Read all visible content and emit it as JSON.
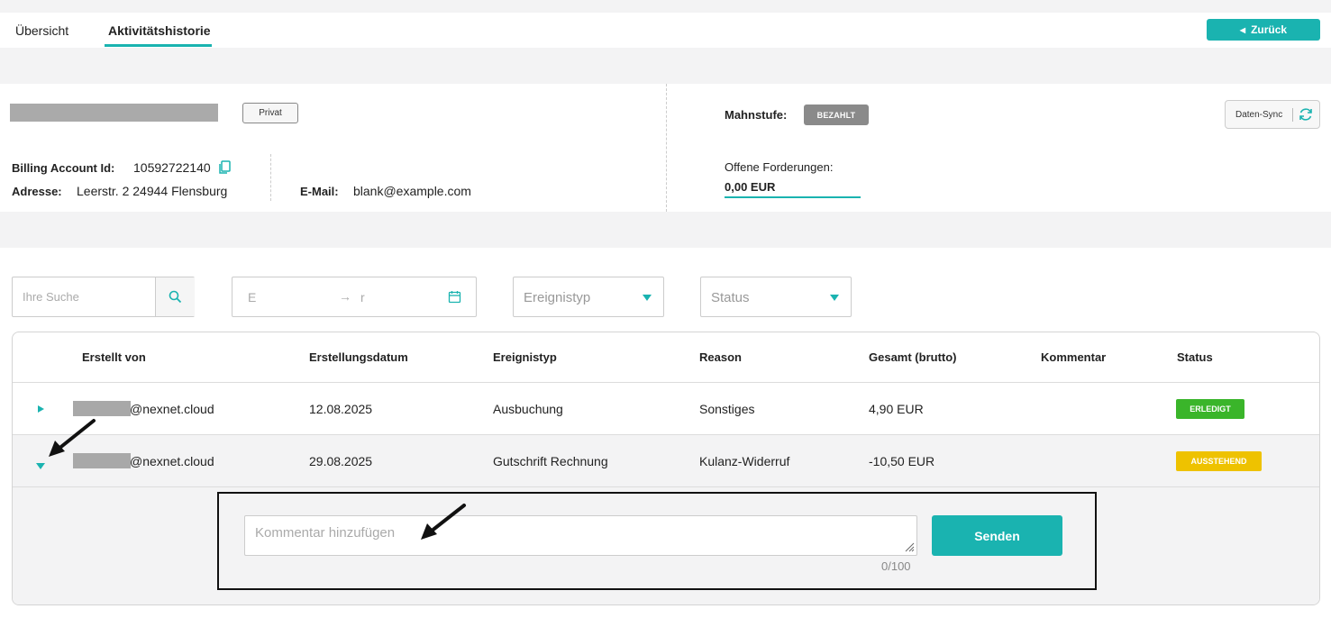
{
  "tabs": {
    "overview": "Übersicht",
    "history": "Aktivitätshistorie"
  },
  "back_button": "Zurück",
  "account": {
    "badge": "Privat",
    "billing_label": "Billing Account Id:",
    "billing_id": "10592722140",
    "address_label": "Adresse:",
    "address": "Leerstr. 2 24944 Flensburg",
    "email_label": "E-Mail:",
    "email": "blank@example.com",
    "mahnstufe_label": "Mahnstufe:",
    "mahnstufe_badge": "BEZAHLT",
    "offene_label": "Offene Forderungen:",
    "offene_value": "0,00 EUR",
    "sync_label": "Daten-Sync"
  },
  "filters": {
    "search_placeholder": "Ihre Suche",
    "date_start": "E",
    "date_arrow": "→",
    "date_end": "r",
    "event_type": "Ereignistyp",
    "status": "Status"
  },
  "table": {
    "headers": [
      "Erstellt von",
      "Erstellungsdatum",
      "Ereignistyp",
      "Reason",
      "Gesamt (brutto)",
      "Kommentar",
      "Status"
    ],
    "rows": [
      {
        "created_by_suffix": "@nexnet.cloud",
        "date": "12.08.2025",
        "event_type": "Ausbuchung",
        "reason": "Sonstiges",
        "total": "4,90 EUR",
        "comment": "",
        "status": "ERLEDIGT"
      },
      {
        "created_by_suffix": "@nexnet.cloud",
        "date": "29.08.2025",
        "event_type": "Gutschrift Rechnung",
        "reason": "Kulanz-Widerruf",
        "total": "-10,50 EUR",
        "comment": "",
        "status": "AUSSTEHEND"
      }
    ]
  },
  "comment": {
    "placeholder": "Kommentar hinzufügen",
    "send": "Senden",
    "counter": "0/100"
  },
  "colors": {
    "accent": "#1ab3b0",
    "erledigt": "#3ab52a",
    "ausstehend": "#eec200",
    "bezahlt": "#8a8a8a"
  }
}
